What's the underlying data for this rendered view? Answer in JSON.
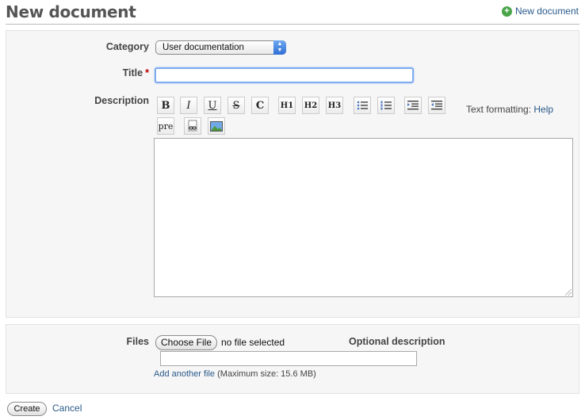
{
  "header": {
    "title": "New document",
    "new_document_link": "New document"
  },
  "form": {
    "category": {
      "label": "Category",
      "selected": "User documentation"
    },
    "title": {
      "label": "Title",
      "required_marker": "*",
      "value": ""
    },
    "description": {
      "label": "Description",
      "toolbar": [
        {
          "name": "bold-button",
          "glyph": "B"
        },
        {
          "name": "italic-button",
          "glyph": "I"
        },
        {
          "name": "underline-button",
          "glyph": "U"
        },
        {
          "name": "strikethrough-button",
          "glyph": "S"
        },
        {
          "name": "code-button",
          "glyph": "C"
        },
        {
          "name": "heading1-button",
          "glyph": "H1"
        },
        {
          "name": "heading2-button",
          "glyph": "H2"
        },
        {
          "name": "heading3-button",
          "glyph": "H3"
        },
        {
          "name": "unordered-list-button",
          "glyph": "ul-icon"
        },
        {
          "name": "ordered-list-button",
          "glyph": "ol-icon"
        },
        {
          "name": "indent-button",
          "glyph": "indent-icon"
        },
        {
          "name": "outdent-button",
          "glyph": "outdent-icon"
        },
        {
          "name": "preformatted-button",
          "glyph": "pre"
        },
        {
          "name": "link-button",
          "glyph": "link-icon"
        },
        {
          "name": "image-button",
          "glyph": "image-icon"
        }
      ],
      "formatting_label": "Text formatting:",
      "help_link": "Help",
      "value": ""
    }
  },
  "files": {
    "label": "Files",
    "choose_button": "Choose File",
    "no_file_text": "no file selected",
    "optional_description_label": "Optional description",
    "add_another_link": "Add another file",
    "max_size_text": "(Maximum size: 15.6 MB)"
  },
  "actions": {
    "create_button": "Create",
    "cancel_link": "Cancel"
  }
}
